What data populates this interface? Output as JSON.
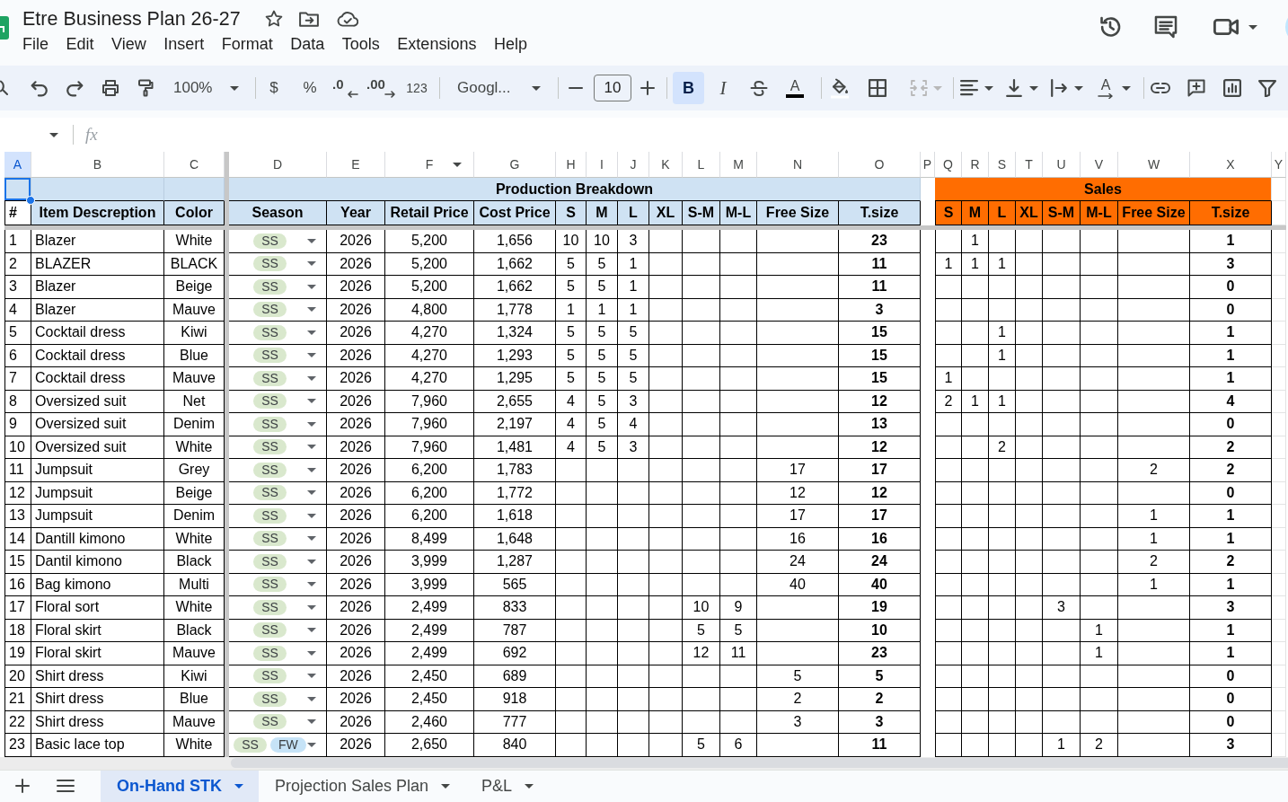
{
  "document": {
    "title": "Etre Business Plan 26-27"
  },
  "menu": [
    "File",
    "Edit",
    "View",
    "Insert",
    "Format",
    "Data",
    "Tools",
    "Extensions",
    "Help"
  ],
  "toolbar": {
    "zoom": "100%",
    "currency": "$",
    "percent": "%",
    "decrease_decimals": ".0",
    "increase_decimals": ".00",
    "more_formats": "123",
    "font": "Googl...",
    "font_size": "10",
    "bold": {
      "label": "B",
      "selected": true
    },
    "italic": {
      "label": "I",
      "selected": false
    },
    "text_color": {
      "label": "A"
    },
    "merge_cells": {
      "disabled": true
    },
    "text_rotation": {
      "label": "A"
    }
  },
  "formula_bar": {
    "function_label": "fx"
  },
  "sheet": {
    "columns": [
      {
        "letter": "A",
        "selected": true,
        "hover_menu": false
      },
      {
        "letter": "B",
        "selected": false,
        "hover_menu": false
      },
      {
        "letter": "C",
        "selected": false,
        "hover_menu": false
      },
      {
        "letter": "D",
        "selected": false,
        "hover_menu": false
      },
      {
        "letter": "E",
        "selected": false,
        "hover_menu": false
      },
      {
        "letter": "F",
        "selected": false,
        "hover_menu": true
      },
      {
        "letter": "G",
        "selected": false,
        "hover_menu": false
      },
      {
        "letter": "H",
        "selected": false,
        "hover_menu": false
      },
      {
        "letter": "I",
        "selected": false,
        "hover_menu": false
      },
      {
        "letter": "J",
        "selected": false,
        "hover_menu": false
      },
      {
        "letter": "K",
        "selected": false,
        "hover_menu": false
      },
      {
        "letter": "L",
        "selected": false,
        "hover_menu": false
      },
      {
        "letter": "M",
        "selected": false,
        "hover_menu": false
      },
      {
        "letter": "N",
        "selected": false,
        "hover_menu": false
      },
      {
        "letter": "O",
        "selected": false,
        "hover_menu": false
      },
      {
        "letter": "P",
        "selected": false,
        "hover_menu": false
      },
      {
        "letter": "Q",
        "selected": false,
        "hover_menu": false
      },
      {
        "letter": "R",
        "selected": false,
        "hover_menu": false
      },
      {
        "letter": "S",
        "selected": false,
        "hover_menu": false
      },
      {
        "letter": "T",
        "selected": false,
        "hover_menu": false
      },
      {
        "letter": "U",
        "selected": false,
        "hover_menu": false
      },
      {
        "letter": "V",
        "selected": false,
        "hover_menu": false
      },
      {
        "letter": "W",
        "selected": false,
        "hover_menu": false
      },
      {
        "letter": "X",
        "selected": false,
        "hover_menu": false
      },
      {
        "letter": "Y",
        "selected": false,
        "hover_menu": false
      }
    ],
    "groups": [
      {
        "title": "Production Breakdown",
        "color": "#cfe2f3",
        "headers": [
          "S",
          "M",
          "L",
          "XL",
          "S-M",
          "M-L",
          "Free Size",
          "T.size"
        ]
      },
      {
        "title": "Sales",
        "color": "#ff6d01",
        "headers": [
          "S",
          "M",
          "L",
          "XL",
          "S-M",
          "M-L",
          "Free Size",
          "T.size"
        ]
      }
    ],
    "headers": [
      "#",
      "Item Descreption",
      "Color",
      "Season",
      "Year",
      "Retail Price",
      "Cost Price"
    ],
    "rows": [
      {
        "number": "1",
        "item": "Blazer",
        "item_color": "White",
        "season": [
          {
            "label": "SS",
            "color": "#d9e8cd"
          }
        ],
        "year": "2026",
        "retail_price": "5,200",
        "cost_price": "1,656",
        "production": {
          "s": "10",
          "m": "10",
          "l": "3",
          "t_size": "23"
        },
        "sales": {
          "m": "1",
          "t_size": "1"
        }
      },
      {
        "number": "2",
        "item": "BLAZER",
        "item_color": "BLACK",
        "season": [
          {
            "label": "SS",
            "color": "#d9e8cd"
          }
        ],
        "year": "2026",
        "retail_price": "5,200",
        "cost_price": "1,662",
        "production": {
          "s": "5",
          "m": "5",
          "l": "1",
          "t_size": "11"
        },
        "sales": {
          "s": "1",
          "m": "1",
          "l": "1",
          "t_size": "3"
        }
      },
      {
        "number": "3",
        "item": "Blazer",
        "item_color": "Beige",
        "season": [
          {
            "label": "SS",
            "color": "#d9e8cd"
          }
        ],
        "year": "2026",
        "retail_price": "5,200",
        "cost_price": "1,662",
        "production": {
          "s": "5",
          "m": "5",
          "l": "1",
          "t_size": "11"
        },
        "sales": {
          "t_size": "0"
        }
      },
      {
        "number": "4",
        "item": "Blazer",
        "item_color": "Mauve",
        "season": [
          {
            "label": "SS",
            "color": "#d9e8cd"
          }
        ],
        "year": "2026",
        "retail_price": "4,800",
        "cost_price": "1,778",
        "production": {
          "s": "1",
          "m": "1",
          "l": "1",
          "t_size": "3"
        },
        "sales": {
          "t_size": "0"
        }
      },
      {
        "number": "5",
        "item": "Cocktail dress",
        "item_color": "Kiwi",
        "season": [
          {
            "label": "SS",
            "color": "#d9e8cd"
          }
        ],
        "year": "2026",
        "retail_price": "4,270",
        "cost_price": "1,324",
        "production": {
          "s": "5",
          "m": "5",
          "l": "5",
          "t_size": "15"
        },
        "sales": {
          "l": "1",
          "t_size": "1"
        }
      },
      {
        "number": "6",
        "item": "Cocktail dress",
        "item_color": "Blue",
        "season": [
          {
            "label": "SS",
            "color": "#d9e8cd"
          }
        ],
        "year": "2026",
        "retail_price": "4,270",
        "cost_price": "1,293",
        "production": {
          "s": "5",
          "m": "5",
          "l": "5",
          "t_size": "15"
        },
        "sales": {
          "l": "1",
          "t_size": "1"
        }
      },
      {
        "number": "7",
        "item": "Cocktail dress",
        "item_color": "Mauve",
        "season": [
          {
            "label": "SS",
            "color": "#d9e8cd"
          }
        ],
        "year": "2026",
        "retail_price": "4,270",
        "cost_price": "1,295",
        "production": {
          "s": "5",
          "m": "5",
          "l": "5",
          "t_size": "15"
        },
        "sales": {
          "s": "1",
          "t_size": "1"
        }
      },
      {
        "number": "8",
        "item": "Oversized suit",
        "item_color": "Net",
        "season": [
          {
            "label": "SS",
            "color": "#d9e8cd"
          }
        ],
        "year": "2026",
        "retail_price": "7,960",
        "cost_price": "2,655",
        "production": {
          "s": "4",
          "m": "5",
          "l": "3",
          "t_size": "12"
        },
        "sales": {
          "s": "2",
          "m": "1",
          "l": "1",
          "t_size": "4"
        }
      },
      {
        "number": "9",
        "item": "Oversized suit",
        "item_color": "Denim",
        "season": [
          {
            "label": "SS",
            "color": "#d9e8cd"
          }
        ],
        "year": "2026",
        "retail_price": "7,960",
        "cost_price": "2,197",
        "production": {
          "s": "4",
          "m": "5",
          "l": "4",
          "t_size": "13"
        },
        "sales": {
          "t_size": "0"
        }
      },
      {
        "number": "10",
        "item": "Oversized suit",
        "item_color": "White",
        "season": [
          {
            "label": "SS",
            "color": "#d9e8cd"
          }
        ],
        "year": "2026",
        "retail_price": "7,960",
        "cost_price": "1,481",
        "production": {
          "s": "4",
          "m": "5",
          "l": "3",
          "t_size": "12"
        },
        "sales": {
          "l": "2",
          "t_size": "2"
        }
      },
      {
        "number": "11",
        "item": "Jumpsuit",
        "item_color": "Grey",
        "season": [
          {
            "label": "SS",
            "color": "#d9e8cd"
          }
        ],
        "year": "2026",
        "retail_price": "6,200",
        "cost_price": "1,783",
        "production": {
          "free_size": "17",
          "t_size": "17"
        },
        "sales": {
          "free_size": "2",
          "t_size": "2"
        }
      },
      {
        "number": "12",
        "item": "Jumpsuit",
        "item_color": "Beige",
        "season": [
          {
            "label": "SS",
            "color": "#d9e8cd"
          }
        ],
        "year": "2026",
        "retail_price": "6,200",
        "cost_price": "1,772",
        "production": {
          "free_size": "12",
          "t_size": "12"
        },
        "sales": {
          "t_size": "0"
        }
      },
      {
        "number": "13",
        "item": "Jumpsuit",
        "item_color": "Denim",
        "season": [
          {
            "label": "SS",
            "color": "#d9e8cd"
          }
        ],
        "year": "2026",
        "retail_price": "6,200",
        "cost_price": "1,618",
        "production": {
          "free_size": "17",
          "t_size": "17"
        },
        "sales": {
          "free_size": "1",
          "t_size": "1"
        }
      },
      {
        "number": "14",
        "item": "Dantill kimono",
        "item_color": "White",
        "season": [
          {
            "label": "SS",
            "color": "#d9e8cd"
          }
        ],
        "year": "2026",
        "retail_price": "8,499",
        "cost_price": "1,648",
        "production": {
          "free_size": "16",
          "t_size": "16"
        },
        "sales": {
          "free_size": "1",
          "t_size": "1"
        }
      },
      {
        "number": "15",
        "item": "Dantil kimono",
        "item_color": "Black",
        "season": [
          {
            "label": "SS",
            "color": "#d9e8cd"
          }
        ],
        "year": "2026",
        "retail_price": "3,999",
        "cost_price": "1,287",
        "production": {
          "free_size": "24",
          "t_size": "24"
        },
        "sales": {
          "free_size": "2",
          "t_size": "2"
        }
      },
      {
        "number": "16",
        "item": "Bag kimono",
        "item_color": "Multi",
        "season": [
          {
            "label": "SS",
            "color": "#d9e8cd"
          }
        ],
        "year": "2026",
        "retail_price": "3,999",
        "cost_price": "565",
        "production": {
          "free_size": "40",
          "t_size": "40"
        },
        "sales": {
          "free_size": "1",
          "t_size": "1"
        }
      },
      {
        "number": "17",
        "item": "Floral sort",
        "item_color": "White",
        "season": [
          {
            "label": "SS",
            "color": "#d9e8cd"
          }
        ],
        "year": "2026",
        "retail_price": "2,499",
        "cost_price": "833",
        "production": {
          "s_m": "10",
          "m_l": "9",
          "t_size": "19"
        },
        "sales": {
          "s_m": "3",
          "t_size": "3"
        }
      },
      {
        "number": "18",
        "item": "Floral skirt",
        "item_color": "Black",
        "season": [
          {
            "label": "SS",
            "color": "#d9e8cd"
          }
        ],
        "year": "2026",
        "retail_price": "2,499",
        "cost_price": "787",
        "production": {
          "s_m": "5",
          "m_l": "5",
          "t_size": "10"
        },
        "sales": {
          "m_l": "1",
          "t_size": "1"
        }
      },
      {
        "number": "19",
        "item": "Floral skirt",
        "item_color": "Mauve",
        "season": [
          {
            "label": "SS",
            "color": "#d9e8cd"
          }
        ],
        "year": "2026",
        "retail_price": "2,499",
        "cost_price": "692",
        "production": {
          "s_m": "12",
          "m_l": "11",
          "t_size": "23"
        },
        "sales": {
          "m_l": "1",
          "t_size": "1"
        }
      },
      {
        "number": "20",
        "item": "Shirt dress",
        "item_color": "Kiwi",
        "season": [
          {
            "label": "SS",
            "color": "#d9e8cd"
          }
        ],
        "year": "2026",
        "retail_price": "2,450",
        "cost_price": "689",
        "production": {
          "free_size": "5",
          "t_size": "5"
        },
        "sales": {
          "t_size": "0"
        }
      },
      {
        "number": "21",
        "item": "Shirt dress",
        "item_color": "Blue",
        "season": [
          {
            "label": "SS",
            "color": "#d9e8cd"
          }
        ],
        "year": "2026",
        "retail_price": "2,450",
        "cost_price": "918",
        "production": {
          "free_size": "2",
          "t_size": "2"
        },
        "sales": {
          "t_size": "0"
        }
      },
      {
        "number": "22",
        "item": "Shirt dress",
        "item_color": "Mauve",
        "season": [
          {
            "label": "SS",
            "color": "#d9e8cd"
          }
        ],
        "year": "2026",
        "retail_price": "2,460",
        "cost_price": "777",
        "production": {
          "free_size": "3",
          "t_size": "3"
        },
        "sales": {
          "t_size": "0"
        }
      },
      {
        "number": "23",
        "item": "Basic lace top",
        "item_color": "White",
        "season": [
          {
            "label": "SS",
            "color": "#d9e8cd"
          },
          {
            "label": "FW",
            "color": "#c6e3f7"
          }
        ],
        "year": "2026",
        "retail_price": "2,650",
        "cost_price": "840",
        "production": {
          "s_m": "5",
          "m_l": "6",
          "t_size": "11"
        },
        "sales": {
          "s_m": "1",
          "m_l": "2",
          "t_size": "3"
        }
      }
    ]
  },
  "tabs": [
    {
      "label": "On-Hand STK",
      "selected": true
    },
    {
      "label": "Projection Sales Plan",
      "selected": false
    },
    {
      "label": "P&L",
      "selected": false
    }
  ]
}
